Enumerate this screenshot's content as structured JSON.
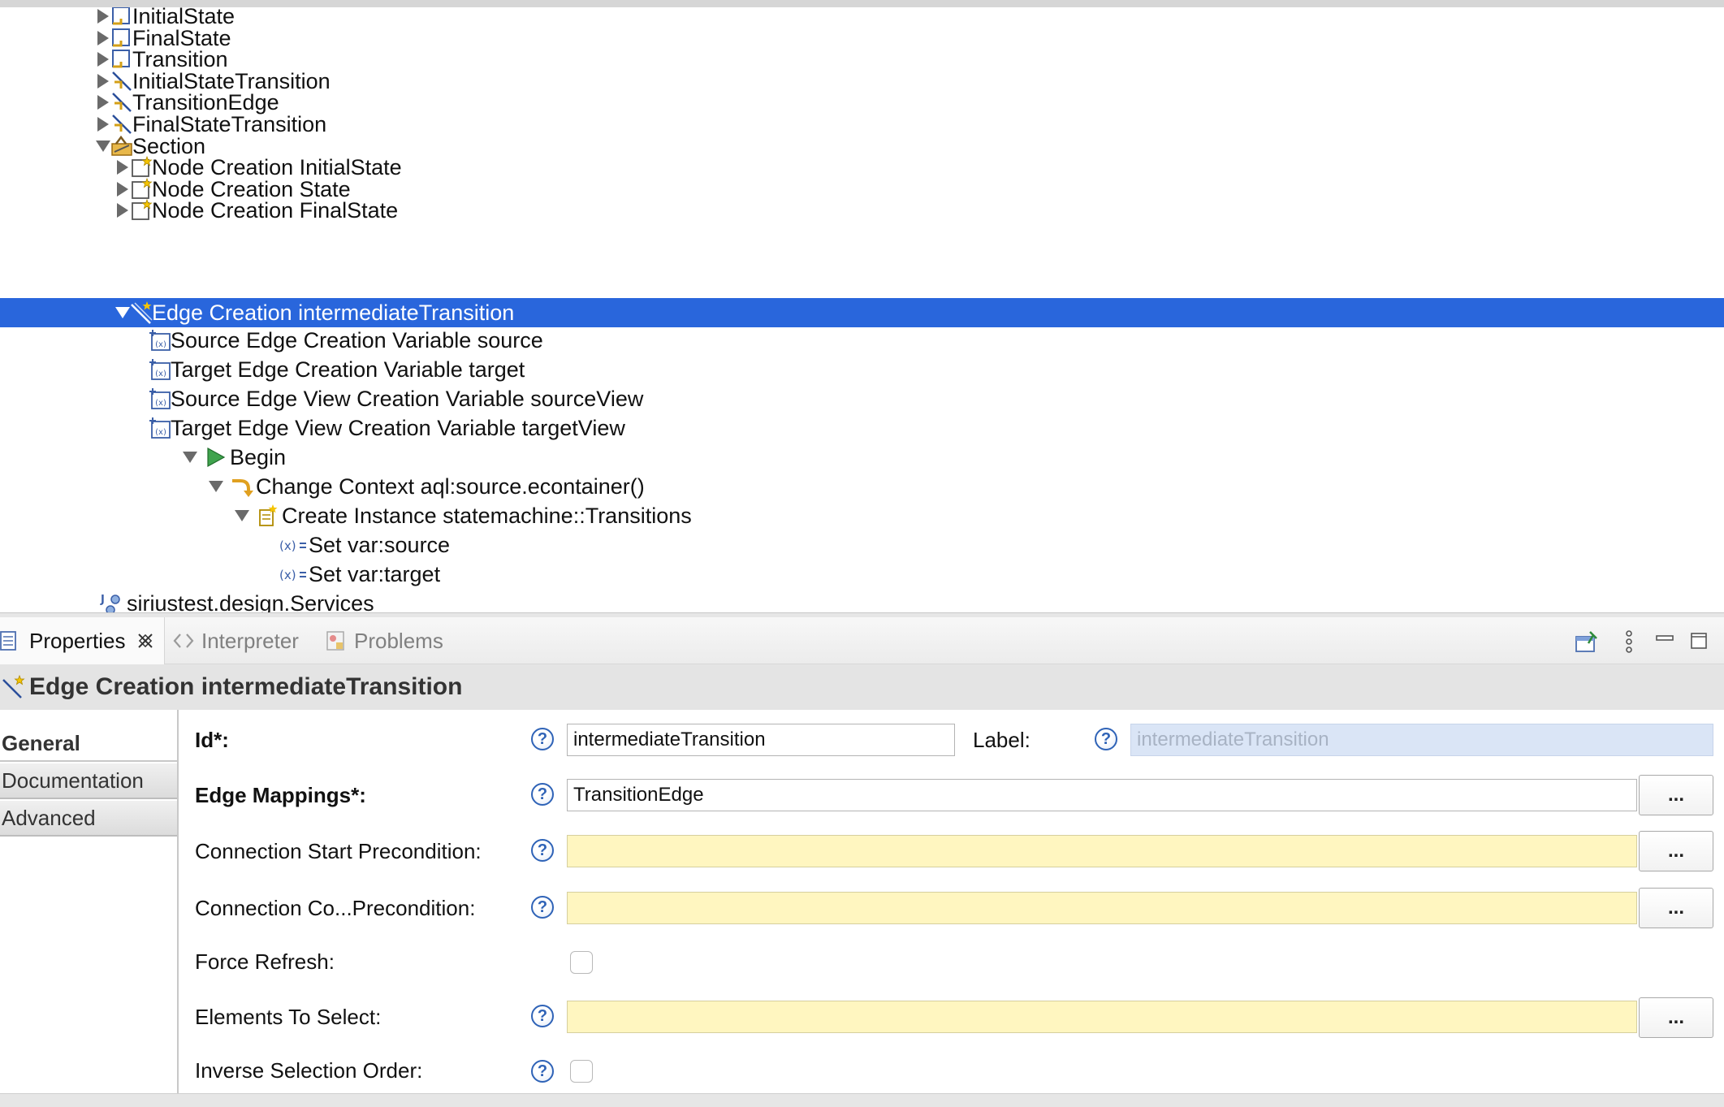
{
  "tree": {
    "items": [
      {
        "label": "InitialState",
        "icon": "node-mapping-icon",
        "expanded": false
      },
      {
        "label": "FinalState",
        "icon": "node-mapping-icon",
        "expanded": false
      },
      {
        "label": "Transition",
        "icon": "node-mapping-icon",
        "expanded": false
      },
      {
        "label": "InitialStateTransition",
        "icon": "edge-mapping-icon",
        "expanded": false
      },
      {
        "label": "TransitionEdge",
        "icon": "edge-mapping-icon",
        "expanded": false
      },
      {
        "label": "FinalStateTransition",
        "icon": "edge-mapping-icon",
        "expanded": false
      },
      {
        "label": "Section",
        "icon": "tools-section-icon",
        "expanded": true
      },
      {
        "label": "Node Creation InitialState",
        "icon": "node-creation-icon",
        "expanded": false
      },
      {
        "label": "Node Creation State",
        "icon": "node-creation-icon",
        "expanded": false
      },
      {
        "label": "Node Creation FinalState",
        "icon": "node-creation-icon",
        "expanded": false
      },
      {
        "label": "Edge Creation intermediateTransition",
        "icon": "edge-creation-icon",
        "expanded": true,
        "selected": true
      },
      {
        "label": "Source Edge Creation Variable source",
        "icon": "variable-icon"
      },
      {
        "label": "Target Edge Creation Variable target",
        "icon": "variable-icon"
      },
      {
        "label": "Source Edge View Creation Variable sourceView",
        "icon": "variable-icon"
      },
      {
        "label": "Target Edge View Creation Variable targetView",
        "icon": "variable-icon"
      },
      {
        "label": "Begin",
        "icon": "begin-icon",
        "expanded": true
      },
      {
        "label": "Change Context aql:source.econtainer()",
        "icon": "change-context-icon",
        "expanded": true
      },
      {
        "label": "Create Instance statemachine::Transitions",
        "icon": "create-instance-icon",
        "expanded": true
      },
      {
        "label": "Set var:source",
        "icon": "set-value-icon"
      },
      {
        "label": "Set var:target",
        "icon": "set-value-icon"
      },
      {
        "label": "siriustest.design.Services",
        "icon": "java-extension-icon"
      }
    ]
  },
  "tabs": [
    {
      "label": "Properties",
      "active": true
    },
    {
      "label": "Interpreter",
      "active": false
    },
    {
      "label": "Problems",
      "active": false
    }
  ],
  "properties": {
    "title": "Edge Creation intermediateTransition",
    "nav": [
      "General",
      "Documentation",
      "Advanced"
    ],
    "fields": {
      "id_label": "Id*:",
      "id_value": "intermediateTransition",
      "label_label": "Label:",
      "label_value": "intermediateTransition",
      "edge_mappings_label": "Edge Mappings*:",
      "edge_mappings_value": "TransitionEdge",
      "start_precondition_label": "Connection Start Precondition:",
      "start_precondition_value": "",
      "complete_precondition_label": "Connection Co...Precondition:",
      "complete_precondition_value": "",
      "force_refresh_label": "Force Refresh:",
      "elements_to_select_label": "Elements To Select:",
      "elements_to_select_value": "",
      "inverse_selection_label": "Inverse Selection Order:"
    },
    "browse_label": "...",
    "help_glyph": "?"
  },
  "colors": {
    "selection": "#2966dc",
    "expression_field": "#fff6c0",
    "disabled_field": "#dae5f6",
    "help_blue": "#2f63b7"
  }
}
